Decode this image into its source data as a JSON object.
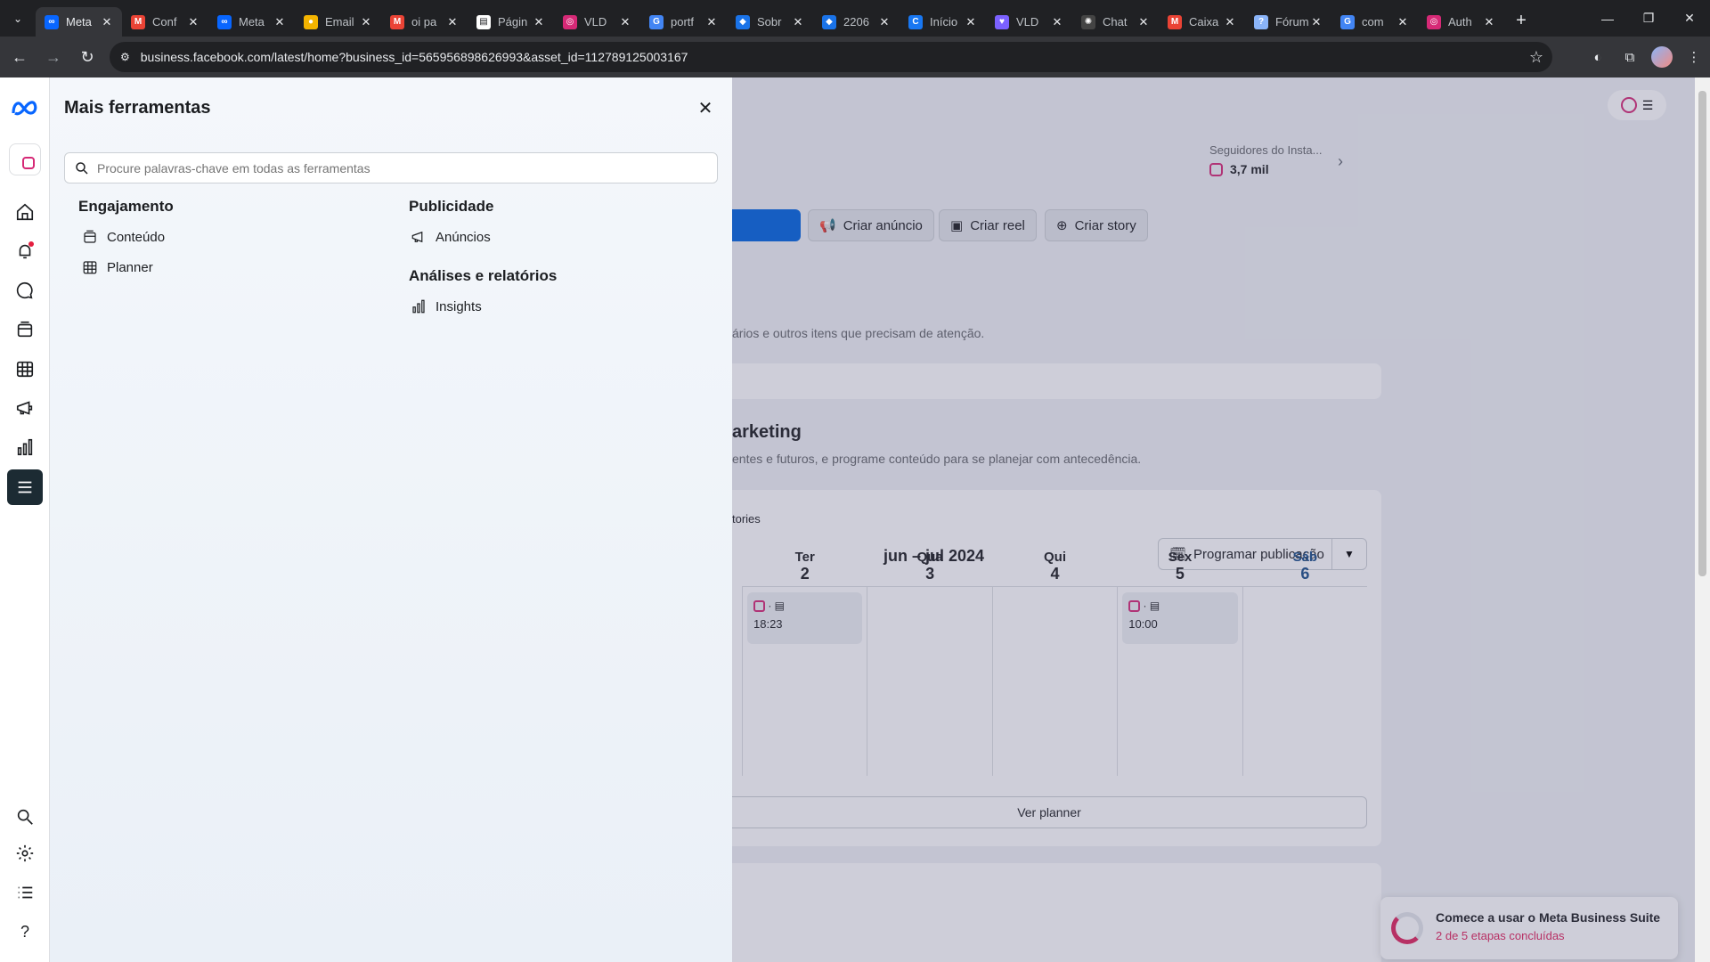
{
  "browser": {
    "tabs": [
      {
        "title": "Meta",
        "fav_color": "#0866ff",
        "fav_char": "∞",
        "active": true
      },
      {
        "title": "Conf",
        "fav_color": "#ea4335",
        "fav_char": "M",
        "active": false
      },
      {
        "title": "Meta",
        "fav_color": "#0866ff",
        "fav_char": "∞",
        "active": false
      },
      {
        "title": "Email",
        "fav_color": "#f4b400",
        "fav_char": "●",
        "active": false
      },
      {
        "title": "oi pa",
        "fav_color": "#ea4335",
        "fav_char": "M",
        "active": false
      },
      {
        "title": "Págin",
        "fav_color": "#ffffff",
        "fav_char": "▤",
        "active": false
      },
      {
        "title": "VLD",
        "fav_color": "#d62976",
        "fav_char": "◎",
        "active": false
      },
      {
        "title": "portf",
        "fav_color": "#4285f4",
        "fav_char": "G",
        "active": false
      },
      {
        "title": "Sobr",
        "fav_color": "#1a73e8",
        "fav_char": "◆",
        "active": false
      },
      {
        "title": "2206",
        "fav_color": "#1a73e8",
        "fav_char": "◆",
        "active": false
      },
      {
        "title": "Início",
        "fav_color": "#1877f2",
        "fav_char": "C",
        "active": false
      },
      {
        "title": "VLD",
        "fav_color": "#7b61ff",
        "fav_char": "♥",
        "active": false
      },
      {
        "title": "Chat",
        "fav_color": "#444444",
        "fav_char": "✺",
        "active": false
      },
      {
        "title": "Caixa",
        "fav_color": "#ea4335",
        "fav_char": "M",
        "active": false
      },
      {
        "title": "Fórum",
        "fav_color": "#8ab4f8",
        "fav_char": "?",
        "active": false
      },
      {
        "title": "com",
        "fav_color": "#4285f4",
        "fav_char": "G",
        "active": false
      },
      {
        "title": "Auth",
        "fav_color": "#d62976",
        "fav_char": "◎",
        "active": false
      }
    ],
    "url": "business.facebook.com/latest/home?business_id=565956898626993&asset_id=112789125003167"
  },
  "background": {
    "followers_label": "Seguidores do Insta...",
    "followers_value": "3,7 mil",
    "buttons": [
      "Criar anúncio",
      "Criar reel",
      "Criar story"
    ],
    "attention_text": "ários e outros itens que precisam de atenção.",
    "marketing_title": "arketing",
    "marketing_sub": "entes e futuros, e programe conteúdo para se planejar com antecedência.",
    "stories_tab": "tories",
    "month": "jun – jul 2024",
    "schedule_button": "Programar publicação",
    "days": [
      {
        "name": "Ter",
        "num": "2",
        "today": false
      },
      {
        "name": "Qua",
        "num": "3",
        "today": false
      },
      {
        "name": "Qui",
        "num": "4",
        "today": false
      },
      {
        "name": "Sex",
        "num": "5",
        "today": false
      },
      {
        "name": "Sáb",
        "num": "6",
        "today": true
      }
    ],
    "posts": [
      {
        "time": "18:23"
      },
      {
        "time": "10:00"
      }
    ],
    "view_planner": "Ver planner",
    "onboarding_title": "Comece a usar o Meta Business Suite",
    "onboarding_sub": "2 de 5 etapas concluídas"
  },
  "panel": {
    "title": "Mais ferramentas",
    "search_placeholder": "Procure palavras-chave em todas as ferramentas",
    "sections": {
      "engagement": {
        "title": "Engajamento",
        "items": [
          "Conteúdo",
          "Planner"
        ]
      },
      "advertising": {
        "title": "Publicidade",
        "items": [
          "Anúncios"
        ]
      },
      "analytics": {
        "title": "Análises e relatórios",
        "items": [
          "Insights"
        ]
      }
    }
  }
}
